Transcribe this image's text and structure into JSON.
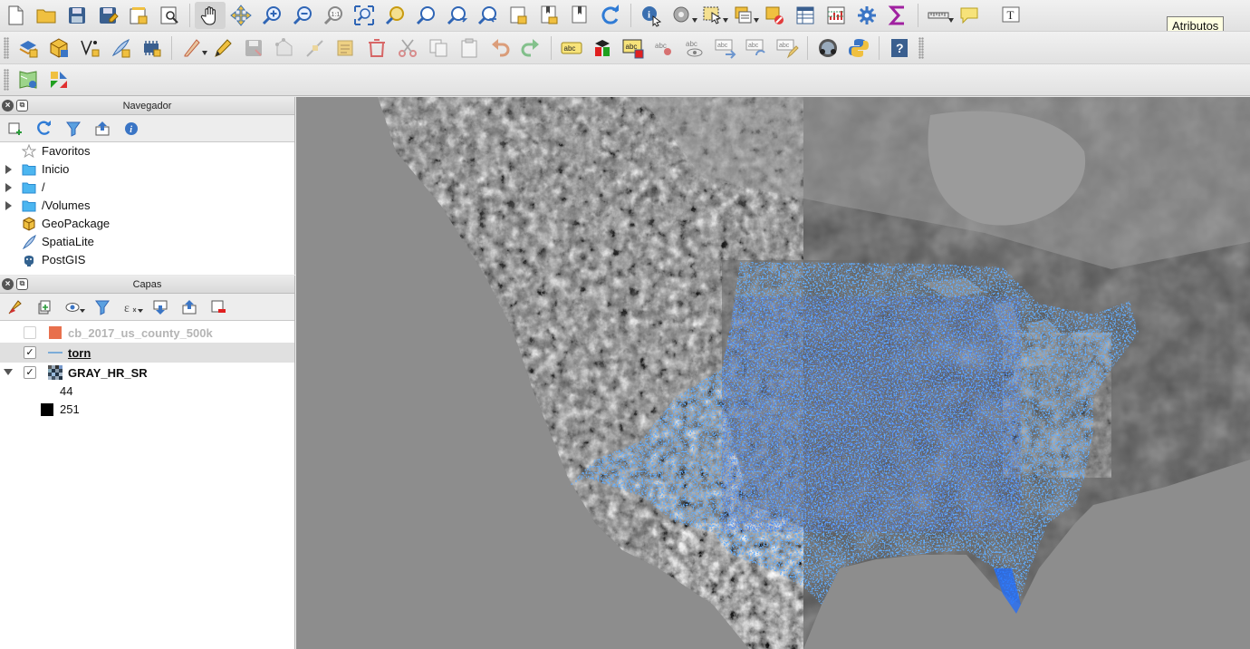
{
  "toolbar_row1": [
    {
      "name": "new-project-icon"
    },
    {
      "name": "open-project-icon"
    },
    {
      "name": "save-project-icon"
    },
    {
      "name": "save-as-icon"
    },
    {
      "name": "new-print-layout-icon"
    },
    {
      "name": "layout-manager-icon"
    },
    {
      "name": "pan-map-icon",
      "active": true
    },
    {
      "name": "pan-to-selection-icon"
    },
    {
      "name": "zoom-in-icon"
    },
    {
      "name": "zoom-out-icon"
    },
    {
      "name": "zoom-native-icon"
    },
    {
      "name": "zoom-full-icon"
    },
    {
      "name": "zoom-to-selection-icon"
    },
    {
      "name": "zoom-to-layer-icon"
    },
    {
      "name": "zoom-last-icon"
    },
    {
      "name": "zoom-next-icon"
    },
    {
      "name": "new-bookmark-icon"
    },
    {
      "name": "show-bookmarks-icon"
    },
    {
      "name": "new-map-view-icon"
    },
    {
      "name": "refresh-icon"
    },
    {
      "name": "identify-icon"
    },
    {
      "name": "run-action-icon"
    },
    {
      "name": "select-features-icon"
    },
    {
      "name": "select-by-value-icon"
    },
    {
      "name": "deselect-icon"
    },
    {
      "name": "attribute-table-icon"
    },
    {
      "name": "field-calculator-icon"
    },
    {
      "name": "toolbox-icon"
    },
    {
      "name": "statistics-icon"
    },
    {
      "name": "measure-icon"
    },
    {
      "name": "map-tips-icon"
    },
    {
      "name": "text-annotation-icon"
    }
  ],
  "toolbar_row2": [
    {
      "name": "add-vector-layer-icon"
    },
    {
      "name": "add-spatialite-icon"
    },
    {
      "name": "add-raster-icon"
    },
    {
      "name": "new-shapefile-icon"
    },
    {
      "name": "new-temp-layer-icon"
    },
    {
      "name": "current-edits-icon"
    },
    {
      "name": "toggle-editing-icon"
    },
    {
      "name": "save-edits-icon"
    },
    {
      "name": "add-feature-icon"
    },
    {
      "name": "vertex-tool-icon"
    },
    {
      "name": "modify-attributes-icon"
    },
    {
      "name": "delete-selected-icon"
    },
    {
      "name": "cut-features-icon"
    },
    {
      "name": "copy-features-icon"
    },
    {
      "name": "paste-features-icon"
    },
    {
      "name": "undo-icon"
    },
    {
      "name": "redo-icon"
    },
    {
      "name": "label-toolbar-icon"
    },
    {
      "name": "diagram-icon"
    },
    {
      "name": "highlight-label-icon"
    },
    {
      "name": "pin-label-icon"
    },
    {
      "name": "show-hide-labels-icon"
    },
    {
      "name": "move-label-icon"
    },
    {
      "name": "rotate-label-icon"
    },
    {
      "name": "change-label-icon"
    },
    {
      "name": "python-console-icon"
    },
    {
      "name": "python-icon"
    },
    {
      "name": "help-icon"
    }
  ],
  "toolbar_row3": [
    {
      "name": "georeferencer-icon"
    },
    {
      "name": "processing-icon"
    }
  ],
  "tooltip": "Atributos",
  "navigator": {
    "title": "Navegador",
    "items": [
      {
        "label": "Favoritos",
        "icon": "star-icon",
        "expandable": false
      },
      {
        "label": "Inicio",
        "icon": "folder-icon",
        "expandable": true
      },
      {
        "label": "/",
        "icon": "folder-icon",
        "expandable": true
      },
      {
        "label": "/Volumes",
        "icon": "folder-icon",
        "expandable": true
      },
      {
        "label": "GeoPackage",
        "icon": "geopackage-icon",
        "expandable": false
      },
      {
        "label": "SpatiaLite",
        "icon": "spatialite-icon",
        "expandable": false
      },
      {
        "label": "PostGIS",
        "icon": "postgis-icon",
        "expandable": false
      }
    ]
  },
  "layers": {
    "title": "Capas",
    "items": [
      {
        "label": "cb_2017_us_county_500k",
        "checked": false,
        "color": "#e8704d"
      },
      {
        "label": "torn",
        "checked": true,
        "color": "#5b9bd5"
      },
      {
        "label": "GRAY_HR_SR",
        "checked": true,
        "expanded": true
      }
    ],
    "legend": [
      {
        "value": "44"
      },
      {
        "value": "251",
        "color": "#000000"
      }
    ]
  },
  "colors": {
    "tornado_points": "#1e6cff",
    "tornado_points_dark": "#1432c8",
    "hillshade_mid": "#7d7d7d"
  }
}
